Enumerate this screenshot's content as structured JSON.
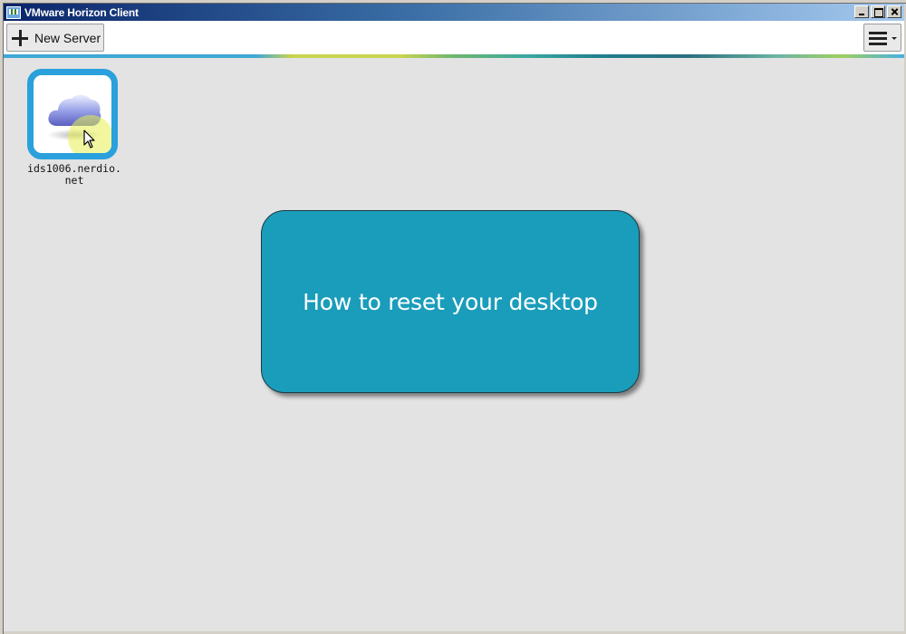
{
  "window": {
    "title": "VMware Horizon Client"
  },
  "toolbar": {
    "new_server_label": "New Server",
    "new_server_icon": "plus-icon",
    "menu_icon": "hamburger-icon"
  },
  "servers": [
    {
      "label": "ids1006.nerdio.net",
      "icon": "cloud-icon"
    }
  ],
  "overlay": {
    "text": "How to reset your desktop"
  },
  "colors": {
    "accent": "#2aa0dc",
    "overlay_bg": "#1a9dba",
    "content_bg": "#e3e3e3"
  }
}
